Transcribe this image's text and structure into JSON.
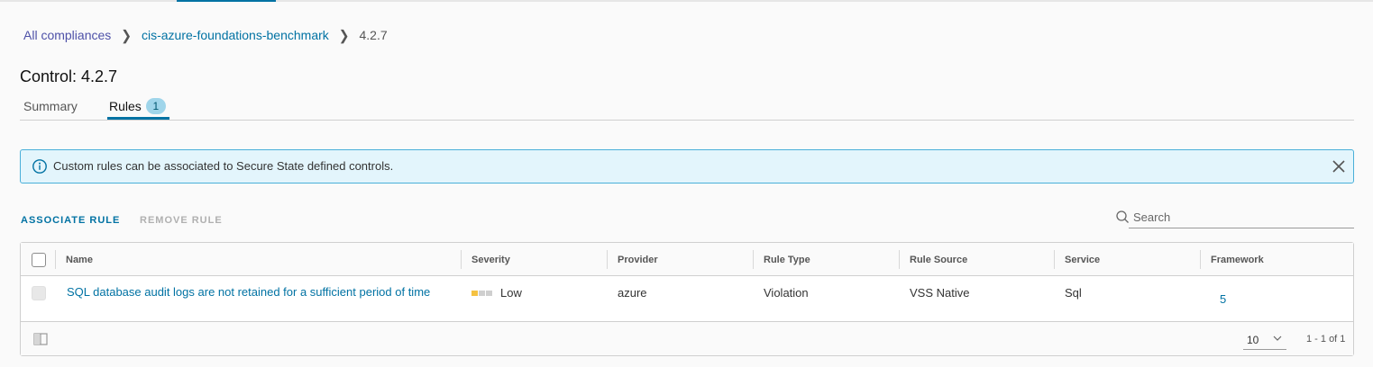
{
  "breadcrumb": {
    "items": [
      "All compliances",
      "cis-azure-foundations-benchmark"
    ],
    "current": "4.2.7"
  },
  "page_title": "Control: 4.2.7",
  "tabs": [
    {
      "label": "Summary",
      "active": false
    },
    {
      "label": "Rules",
      "active": true,
      "badge": "1"
    }
  ],
  "alert": {
    "text": "Custom rules can be associated to Secure State defined controls.",
    "icon": "info-icon",
    "close_icon": "close-icon"
  },
  "actions": {
    "associate_label": "ASSOCIATE RULE",
    "remove_label": "REMOVE RULE"
  },
  "search": {
    "placeholder": "Search",
    "value": ""
  },
  "table": {
    "columns": [
      "Name",
      "Severity",
      "Provider",
      "Rule Type",
      "Rule Source",
      "Service",
      "Framework"
    ],
    "rows": [
      {
        "name": "SQL database audit logs are not retained for a sufficient period of time",
        "severity": "Low",
        "provider": "azure",
        "rule_type": "Violation",
        "rule_source": "VSS Native",
        "service": "Sql",
        "framework": "5"
      }
    ]
  },
  "pagination": {
    "page_size": "10",
    "range": "1 - 1 of 1"
  },
  "colors": {
    "accent": "#0072a3",
    "alert_bg": "#e3f5fc",
    "alert_border": "#49afd9",
    "severity_low": "#f5c242",
    "severity_empty": "#cfcfcf"
  }
}
